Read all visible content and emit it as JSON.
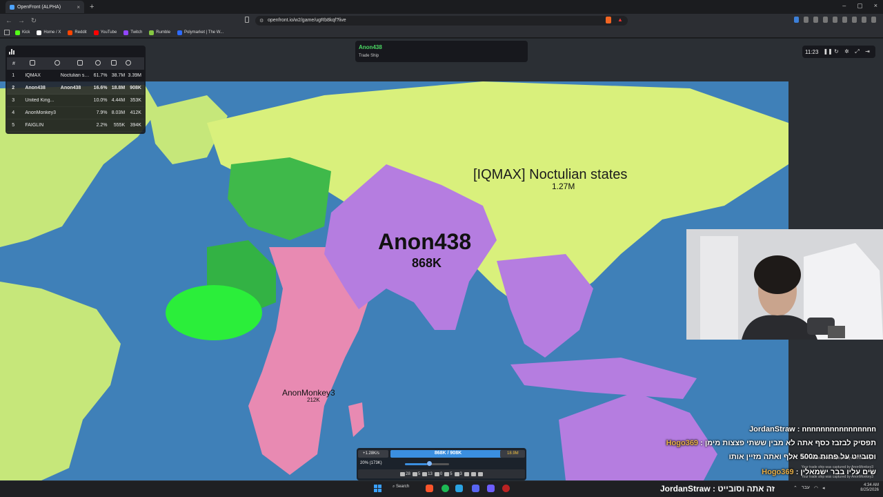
{
  "browser": {
    "tab_title": "OpenFront (ALPHA)",
    "tab_close": "×",
    "new_tab": "+",
    "url": "openfront.io/w2/game/ugRb8kqf?live",
    "window_controls": [
      "–",
      "▢",
      "×"
    ],
    "bookmarks": [
      {
        "label": "Kick",
        "color": "#53fc18"
      },
      {
        "label": "Home / X",
        "color": "#ffffff"
      },
      {
        "label": "Reddit",
        "color": "#ff4500"
      },
      {
        "label": "YouTube",
        "color": "#ff0000"
      },
      {
        "label": "Twitch",
        "color": "#9146ff"
      },
      {
        "label": "Rumble",
        "color": "#85c742"
      },
      {
        "label": "Polymarket | The W...",
        "color": "#2d6bff"
      }
    ]
  },
  "leaderboard": {
    "columns": [
      "#",
      "",
      "",
      "",
      "",
      "",
      ""
    ],
    "rows": [
      {
        "rank": "1",
        "name": "IQMAX",
        "col2": "Noctulian st...",
        "pct": "61.7%",
        "gold": "38.7M",
        "troops": "3.39M"
      },
      {
        "rank": "2",
        "name": "Anon438",
        "col2": "Anon438",
        "pct": "16.6%",
        "gold": "18.8M",
        "troops": "908K"
      },
      {
        "rank": "3",
        "name": "United King...",
        "col2": "",
        "pct": "10.0%",
        "gold": "4.44M",
        "troops": "353K"
      },
      {
        "rank": "4",
        "name": "AnonMonkey3",
        "col2": "",
        "pct": "7.9%",
        "gold": "8.03M",
        "troops": "412K"
      },
      {
        "rank": "5",
        "name": "FAIGLIN",
        "col2": "",
        "pct": "2.2%",
        "gold": "555K",
        "troops": "394K"
      }
    ]
  },
  "notification": {
    "player": "Anon438",
    "message": "Trade Ship"
  },
  "timer": {
    "time": "11:23",
    "icons": [
      "pause-icon",
      "replay-icon",
      "settings-icon",
      "fullscreen-icon",
      "exit-icon"
    ]
  },
  "map_labels": {
    "iqmax_name": "[IQMAX] Noctulian states",
    "iqmax_troops": "1.27M",
    "anon_name": "Anon438",
    "anon_troops": "868K",
    "monkey_name": "AnonMonkey3",
    "monkey_troops": "212K"
  },
  "control_bar": {
    "rate": "+1.28K/s",
    "troops": "868K / 908K",
    "gold": "18.9M",
    "attack_ratio": "20% (173K)",
    "attack_ratio_fraction": 0.5,
    "build_counts": [
      "28",
      "5",
      "13",
      "0",
      "5",
      "3"
    ]
  },
  "chat": [
    {
      "user": "JordanStraw",
      "sep": " : ",
      "text": "nnnnnnnnnnnnnnnn",
      "user_color": "#ffffff"
    },
    {
      "user": "Hogo369",
      "sep": " : ",
      "text": "תפסיק לבזבז כסף אתה לא מבין ששתי פצצות מימן",
      "user_color": "#e8b04a"
    },
    {
      "user": "",
      "sep": "",
      "text": "וסובייט על פחות מ500 אלף ואתה מזיין אותו",
      "user_color": "#ffffff"
    },
    {
      "user": "Hogo369",
      "sep": " : ",
      "text": "שים עליו בבר ישמאלין",
      "user_color": "#e8b04a"
    }
  ],
  "capture_notes": [
    "Your trade ship was captured by AnonMonkey3",
    "Your trade ship was captured by AnonMonkey3",
    "Your trade ship was captured by AnonMonkey3"
  ],
  "taskbar": {
    "search": "Search",
    "caption": "JordanStraw : זה אתה וסובייט",
    "lang": "עבר",
    "time": "4:34 AM",
    "date": "8/25/2026"
  },
  "colors": {
    "ocean": "#3f80b8",
    "land_neutral": "#c6e77a",
    "iqmax": "#d9f07c",
    "anon438": "#b57de0",
    "anonmonkey3": "#e88ab2",
    "united_kingdom": "#3fb94a",
    "accent": "#3b8fe0"
  }
}
